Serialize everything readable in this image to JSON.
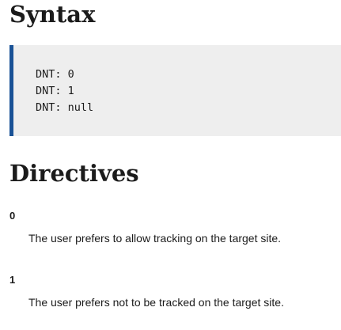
{
  "syntax": {
    "heading": "Syntax",
    "code_lines": [
      "DNT: 0",
      "DNT: 1",
      "DNT: null"
    ]
  },
  "directives": {
    "heading": "Directives",
    "items": [
      {
        "term": "0",
        "description": "The user prefers to allow tracking on the target site."
      },
      {
        "term": "1",
        "description": "The user prefers not to be tracked on the target site."
      }
    ]
  },
  "colors": {
    "code_border": "#1a5296",
    "code_background": "#eeeeee"
  }
}
